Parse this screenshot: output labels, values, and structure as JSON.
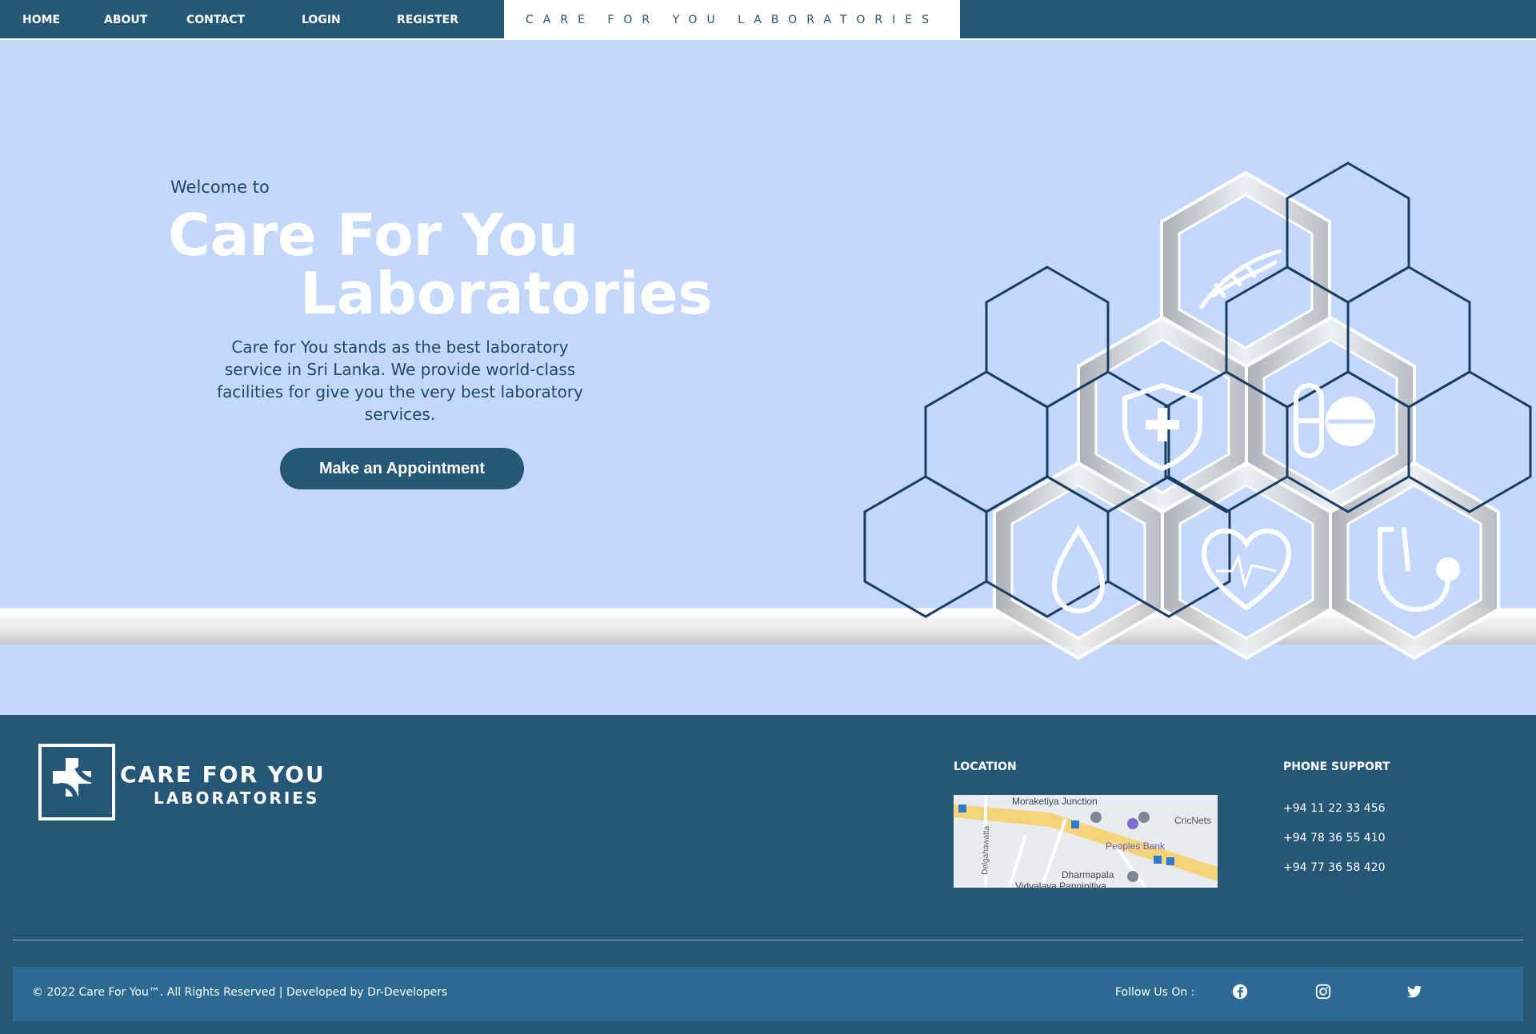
{
  "nav": {
    "items": [
      "HOME",
      "ABOUT",
      "CONTACT",
      "LOGIN",
      "REGISTER"
    ],
    "brand": "CARE FOR YOU LABORATORIES"
  },
  "hero": {
    "welcome": "Welcome to",
    "title_line1": "Care For You",
    "title_line2": "Laboratories",
    "description": "Care for You stands as the best laboratory service in Sri Lanka. We provide world-class facilities for give you the very best laboratory services.",
    "cta_label": "Make an Appointment"
  },
  "footer": {
    "logo_line1": "CARE FOR YOU",
    "logo_line2": "LABORATORIES",
    "location_heading": "LOCATION",
    "map_labels": [
      "Moraketiya Junction",
      "CricNets",
      "Peoples Bank",
      "Delgahawatta",
      "Dharmapala",
      "Vidyalaya Pannipitiya"
    ],
    "phone_heading": "PHONE SUPPORT",
    "phones": [
      "+94 11 22 33 456",
      "+94 78 36 55 410",
      "+94 77 36 58 420"
    ],
    "copyright": "© 2022 Care For You™. All Rights Reserved | Developed by Dr-Developers",
    "follow_label": "Follow Us On :"
  },
  "icons": [
    "dna-icon",
    "shield-plus-icon",
    "pill-icon",
    "blood-drop-icon",
    "heart-pulse-icon",
    "stethoscope-icon",
    "facebook-icon",
    "instagram-icon",
    "twitter-icon"
  ],
  "colors": {
    "navy": "#275777",
    "hero_bg": "#c4d8fd",
    "hex_outline": "#1a3e63",
    "bottom_bar": "#2b6a92"
  }
}
